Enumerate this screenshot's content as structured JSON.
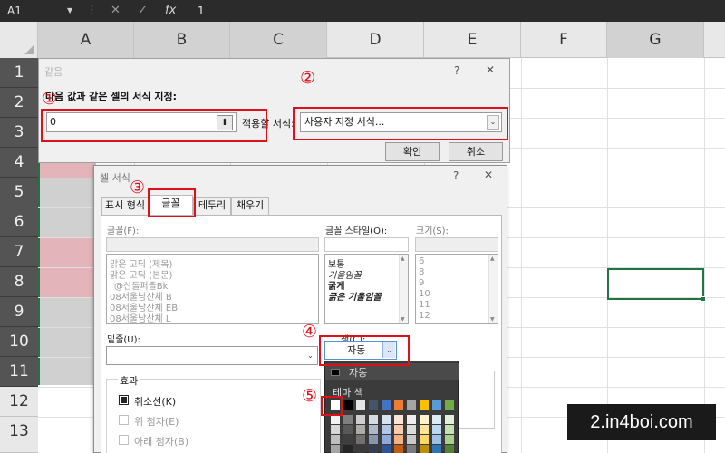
{
  "formula_bar": {
    "name_box": "A1",
    "name_box_caret": "▼",
    "more": "⋮",
    "cancel": "✕",
    "enter": "✓",
    "fx": "fx",
    "value": "1"
  },
  "grid": {
    "columns": [
      "A",
      "B",
      "C",
      "D",
      "E",
      "F",
      "G"
    ],
    "selected_column": "G",
    "rows": [
      "1",
      "2",
      "3",
      "4",
      "5",
      "6",
      "7",
      "8",
      "9",
      "10",
      "11",
      "12",
      "13"
    ],
    "highlight_colors": {
      "gray": "#d0d0d0",
      "pink": "#e3b5bb"
    },
    "accent": "#217346"
  },
  "dialog_equal": {
    "title": "같음",
    "help": "?",
    "close": "✕",
    "prompt": "다음 값과 같은 셀의 서식 지정:",
    "value": "0",
    "collapse_icon": "⬆",
    "apply_label": "적용할 서식:",
    "format_value": "사용자 지정 서식...",
    "combo_arrow": "⌄",
    "ok": "확인",
    "cancel": "취소"
  },
  "dialog_format": {
    "title": "셀 서식",
    "help": "?",
    "close": "✕",
    "tabs": [
      "표시 형식",
      "글꼴",
      "테두리",
      "채우기"
    ],
    "active_tab": "글꼴",
    "font_label": "글꼴(F):",
    "font_list": [
      "맑은 고딕 (제목)",
      "맑은 고딕 (본문)",
      "@산돌퍼즐Bk",
      "08서울남산체 B",
      "08서울남산체 EB",
      "08서울남산체 L"
    ],
    "style_label": "글꼴 스타일(O):",
    "style_list": [
      "보통",
      "기울임꼴",
      "굵게",
      "굵은 기울임꼴"
    ],
    "size_label": "크기(S):",
    "size_list": [
      "6",
      "8",
      "9",
      "10",
      "11",
      "12"
    ],
    "underline_label": "밑줄(U):",
    "underline_arrow": "⌄",
    "color_label": "색(C):",
    "color_value": "자동",
    "color_arrow": "⌄",
    "effects_title": "효과",
    "effects": [
      {
        "label": "취소선(K)",
        "checked": true,
        "enabled": true
      },
      {
        "label": "위 첨자(E)",
        "checked": false,
        "enabled": false
      },
      {
        "label": "아래 첨자(B)",
        "checked": false,
        "enabled": false
      }
    ]
  },
  "color_popup": {
    "auto_label": "자동",
    "theme_label": "테마 색",
    "theme_top_row": [
      "#ffffff",
      "#000000",
      "#e7e6e6",
      "#44546a",
      "#4472c4",
      "#ed7d31",
      "#a5a5a5",
      "#ffc000",
      "#5b9bd5",
      "#70ad47"
    ],
    "theme_shades": [
      [
        "#f2f2f2",
        "#7f7f7f",
        "#d0cece",
        "#d6dce4",
        "#d9e2f3",
        "#fbe4d5",
        "#ededed",
        "#fff2cc",
        "#deebf6",
        "#e2efd9"
      ],
      [
        "#d8d8d8",
        "#595959",
        "#aeabab",
        "#adb9ca",
        "#b4c6e7",
        "#f7cbac",
        "#dbdbdb",
        "#fee599",
        "#bdd7ee",
        "#c5e0b3"
      ],
      [
        "#bfbfbf",
        "#3f3f3f",
        "#757070",
        "#8496b0",
        "#8eaadb",
        "#f4b183",
        "#c9c9c9",
        "#ffd965",
        "#9cc3e5",
        "#a8d08d"
      ],
      [
        "#a5a5a5",
        "#262626",
        "#3a3838",
        "#323f4f",
        "#2f5496",
        "#c55a11",
        "#7b7b7b",
        "#bf8f00",
        "#2e75b5",
        "#538135"
      ]
    ]
  },
  "callouts": [
    "①",
    "②",
    "③",
    "④",
    "⑤"
  ],
  "watermark": "2.in4boi.com"
}
